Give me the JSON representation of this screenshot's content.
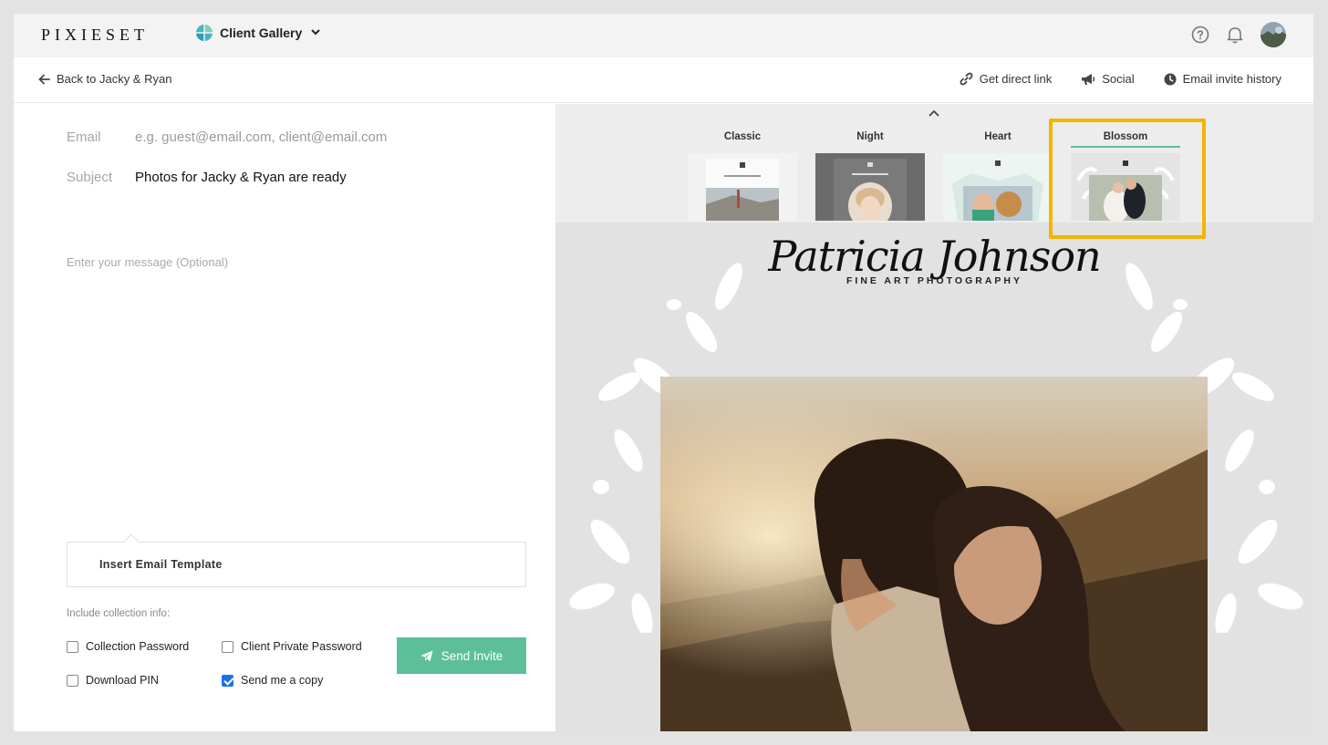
{
  "app": {
    "logo": "PIXIESET",
    "gallery_switch_label": "Client Gallery"
  },
  "subbar": {
    "back_label": "Back to Jacky & Ryan",
    "actions": {
      "direct_link": "Get direct link",
      "social": "Social",
      "email_history": "Email invite history"
    }
  },
  "form": {
    "email_label": "Email",
    "email_placeholder": "e.g. guest@email.com, client@email.com",
    "subject_label": "Subject",
    "subject_value": "Photos for Jacky & Ryan are ready",
    "message_placeholder": "Enter your message (Optional)",
    "template_label": "Insert Email Template",
    "include_label": "Include collection info:",
    "options": {
      "collection_password": "Collection Password",
      "client_private_password": "Client Private Password",
      "download_pin": "Download PIN",
      "send_copy": "Send me a copy"
    },
    "send_label": "Send Invite"
  },
  "themes": {
    "classic": "Classic",
    "night": "Night",
    "heart": "Heart",
    "blossom": "Blossom",
    "selected": "Blossom"
  },
  "preview": {
    "brand_script": "Patricia Johnson",
    "brand_subline": "FINE ART   PHOTOGRAPHY"
  },
  "colors": {
    "accent": "#5cbf9a",
    "highlight": "#f4b400",
    "checkbox": "#1a73e8"
  },
  "icons": {
    "help": "question-circle-icon",
    "notifications": "bell-icon",
    "back": "arrow-left-icon",
    "link": "link-icon",
    "social": "megaphone-icon",
    "history": "clock-icon",
    "send": "paper-plane-icon"
  }
}
